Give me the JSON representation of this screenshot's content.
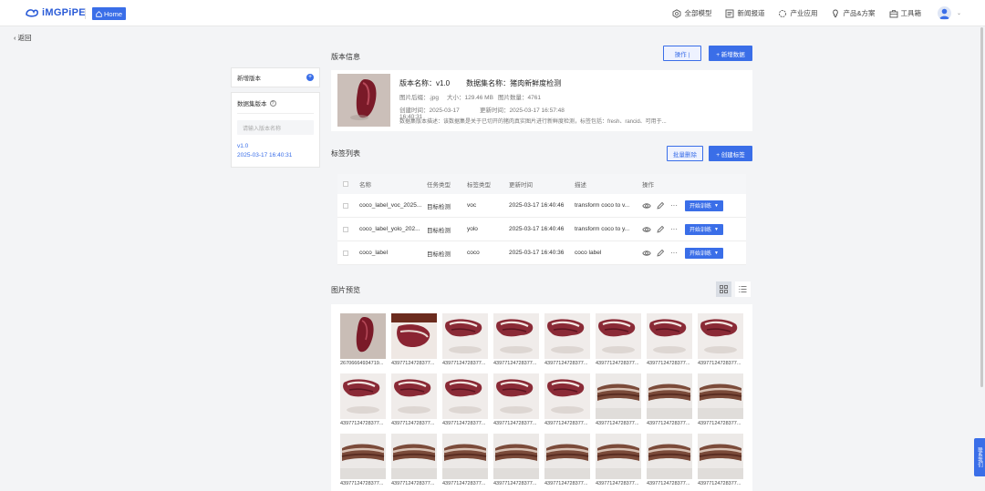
{
  "nav": {
    "logo": "iMGPiPE",
    "home": "Home",
    "items": [
      "全部模型",
      "新闻报道",
      "产业应用",
      "产品&方案",
      "工具箱"
    ]
  },
  "back": "返回",
  "left": {
    "new_version": "新增版本",
    "list_title": "数据集版本",
    "search_placeholder": "请输入版本名称",
    "version": "v1.0",
    "version_date": "2025-03-17 16:40:31"
  },
  "version_info": {
    "title": "版本信息",
    "ops_btn": "操作 |",
    "new_data_btn": "+ 新增数据",
    "name": "版本名称：v1.0",
    "dataset_name": "数据集名称：猪肉新鲜度检测",
    "suffix": "图片后缀：.jpg",
    "size": "大小：129.46 MB",
    "count": "图片数量：4761",
    "created": "创建时间：2025-03-17 16:40:31",
    "updated": "更新时间：2025-03-17 16:57:48",
    "desc": "数据集版本描述：该数据集是关于已切开的猪肉真实图片进行新鲜度检测，标签包括：fresh、rancid、可用于..."
  },
  "labels": {
    "title": "标签列表",
    "batch_delete": "批量删除",
    "create": "+ 创建标签",
    "headers": [
      "名称",
      "任务类型",
      "标签类型",
      "更新时间",
      "描述",
      "操作"
    ],
    "rows": [
      {
        "name": "coco_label_voc_2025...",
        "task": "目标检测",
        "type": "voc",
        "time": "2025-03-17 16:40:46",
        "desc": "transform coco to v...",
        "train": "开始训练"
      },
      {
        "name": "coco_label_yolo_202...",
        "task": "目标检测",
        "type": "yolo",
        "time": "2025-03-17 16:40:46",
        "desc": "transform coco to y...",
        "train": "开始训练"
      },
      {
        "name": "coco_label",
        "task": "目标检测",
        "type": "coco",
        "time": "2025-03-17 16:40:36",
        "desc": "coco label",
        "train": "开始训练"
      }
    ]
  },
  "preview": {
    "title": "图片预览",
    "captions": [
      "26706664934719...",
      "43977124728377...",
      "43977124728377...",
      "43977124728377...",
      "43977124728377...",
      "43977124728377...",
      "43977124728377...",
      "43977124728377...",
      "43977124728377...",
      "43977124728377...",
      "43977124728377...",
      "43977124728377...",
      "43977124728377...",
      "43977124728377...",
      "43977124728377...",
      "43977124728377...",
      "43977124728377...",
      "43977124728377...",
      "43977124728377...",
      "43977124728377...",
      "43977124728377...",
      "43977124728377...",
      "43977124728377...",
      "43977124728377..."
    ]
  },
  "float_tab": "联系我们",
  "colors": {
    "accent": "#3a6ee8"
  }
}
